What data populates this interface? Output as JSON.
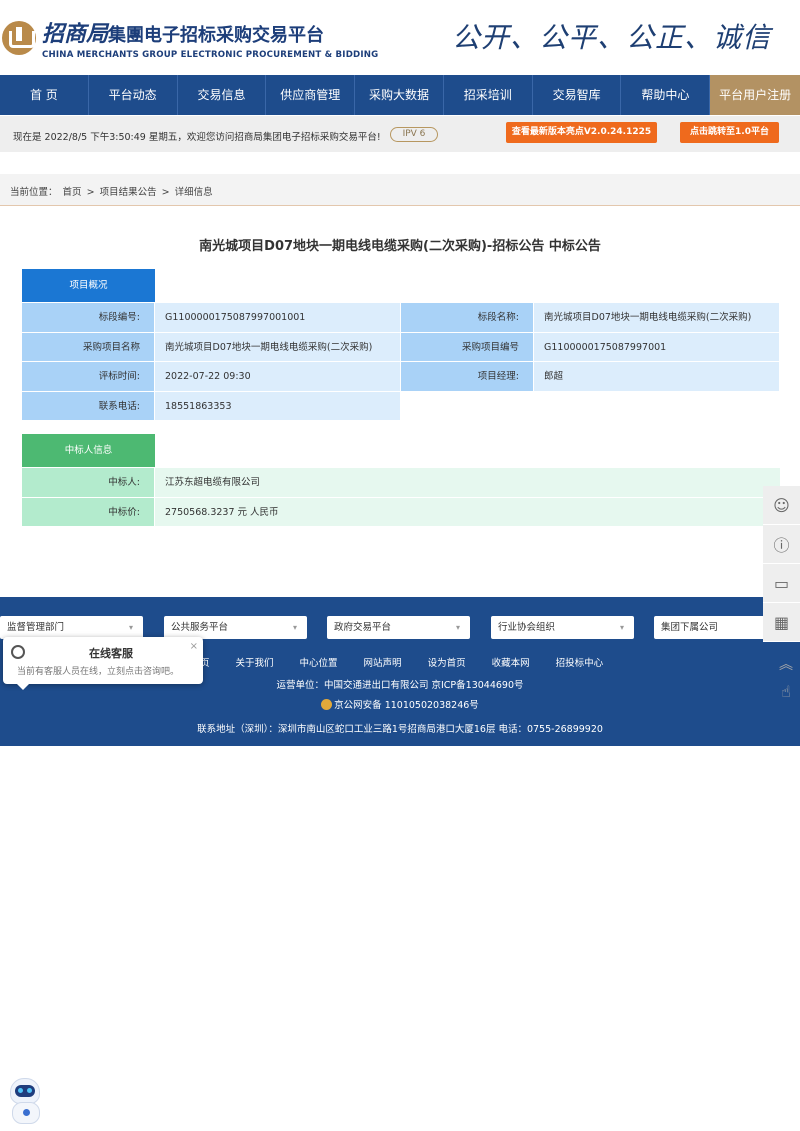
{
  "header": {
    "logo_brand": "招商局",
    "logo_title": "集團电子招标采购交易平台",
    "logo_en": "CHINA MERCHANTS GROUP ELECTRONIC PROCUREMENT & BIDDING",
    "slogan": "公开、公平、公正、诚信"
  },
  "nav": {
    "items": [
      "首 页",
      "平台动态",
      "交易信息",
      "供应商管理",
      "采购大数据",
      "招采培训",
      "交易智库",
      "帮助中心",
      "平台用户注册"
    ]
  },
  "infobar": {
    "welcome": "现在是 2022/8/5 下午3:50:49 星期五，欢迎您访问招商局集团电子招标采购交易平台!",
    "ipv6": "IPV 6",
    "btn_new": "查看最新版本亮点V2.0.24.1225",
    "btn_jump": "点击跳转至1.0平台"
  },
  "breadcrumb": {
    "prefix": "当前位置：",
    "home": "首页",
    "sep": ">",
    "level1": "项目结果公告",
    "level2": "详细信息"
  },
  "notice": {
    "title": "南光城项目D07地块一期电线电缆采购(二次采购)-招标公告 中标公告",
    "overview_head": "项目概况",
    "overview": {
      "section_no_label": "标段编号:",
      "section_no": "G1100000175087997001001",
      "section_name_label": "标段名称:",
      "section_name": "南光城项目D07地块一期电线电缆采购(二次采购)",
      "project_name_label": "采购项目名称",
      "project_name": "南光城项目D07地块一期电线电缆采购(二次采购)",
      "project_no_label": "采购项目编号",
      "project_no": "G1100000175087997001",
      "eval_time_label": "评标时间:",
      "eval_time": "2022-07-22 09:30",
      "manager_label": "项目经理:",
      "manager": "郎超",
      "phone_label": "联系电话:",
      "phone": "18551863353"
    },
    "winner_head": "中标人信息",
    "winner": {
      "winner_label": "中标人:",
      "winner": "江苏东超电缆有限公司",
      "price_label": "中标价:",
      "price": "2750568.3237 元 人民币"
    }
  },
  "footer": {
    "dropdowns": [
      "监督管理部门",
      "公共服务平台",
      "政府交易平台",
      "行业协会组织",
      "集团下属公司"
    ],
    "links": [
      "页",
      "关于我们",
      "中心位置",
      "网站声明",
      "设为首页",
      "收藏本网",
      "招投标中心"
    ],
    "operator": "运营单位：中国交通进出口有限公司    京ICP备13044690号",
    "police": "京公网安备 11010502038246号",
    "address": "联系地址（深圳）：深圳市南山区蛇口工业三路1号招商局港口大厦16层  电话：0755-26899920"
  },
  "chat": {
    "title": "在线客服",
    "subtitle": "当前有客服人员在线，立刻点击咨询吧。",
    "close": "×"
  }
}
